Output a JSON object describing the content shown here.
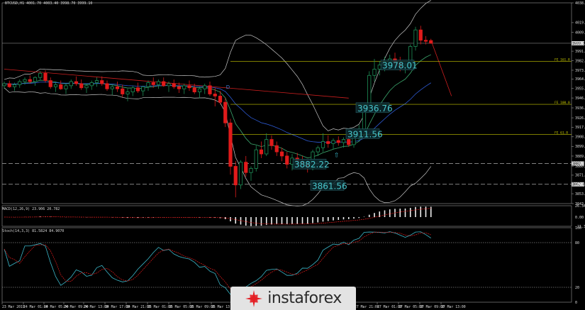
{
  "header": {
    "main_info": "BTCUSD,H1  4001.70 4003.40 3998.70 3999.10",
    "macd_info": "MACD(12,26,9) 23.906 20.782",
    "stoch_info": "Stoch(14,3,3) 81.5824 84.9070"
  },
  "chart_data": [
    {
      "type": "candlestick",
      "symbol": "BTCUSD",
      "timeframe": "H1",
      "ohlc_last": {
        "open": 4001.7,
        "high": 4003.4,
        "low": 3998.7,
        "close": 3999.1
      },
      "current_price": "3999.10",
      "ylim": [
        3843.95,
        4038.2
      ],
      "y_ticks": [
        "4038.20",
        "4019.05",
        "4009.70",
        "3999.10",
        "3991.45",
        "3982.25",
        "3973.00",
        "3964.45",
        "3955.30",
        "3946.15",
        "3936.60",
        "3926.95",
        "3917.80",
        "3908.60",
        "3899.25",
        "3889.95",
        "3880.25",
        "3871.45",
        "3862.60",
        "3853.50",
        "3843.95"
      ],
      "x_ticks": [
        "23 Mar 2019",
        "24 Mar 01:00",
        "24 Mar 05:00",
        "24 Mar 09:00",
        "24 Mar 13:00",
        "24 Mar 17:00",
        "24 Mar 21:00",
        "25 Mar 01:00",
        "25 Mar 05:00",
        "25 Mar 09:00",
        "25 Mar 13:00",
        "25 Mar 17:00",
        "27 Mar 21:00",
        "27 Mar 01:00",
        "27 Mar 05:00",
        "27 Mar 09:00",
        "27 Mar 13:00"
      ],
      "candles": [
        [
          3958,
          3962,
          3955,
          3960
        ],
        [
          3960,
          3963,
          3956,
          3957
        ],
        [
          3957,
          3961,
          3953,
          3959
        ],
        [
          3959,
          3964,
          3956,
          3962
        ],
        [
          3962,
          3966,
          3959,
          3964
        ],
        [
          3964,
          3968,
          3960,
          3962
        ],
        [
          3962,
          3967,
          3958,
          3966
        ],
        [
          3966,
          3972,
          3963,
          3970
        ],
        [
          3970,
          3973,
          3961,
          3963
        ],
        [
          3963,
          3966,
          3955,
          3957
        ],
        [
          3957,
          3961,
          3952,
          3959
        ],
        [
          3959,
          3963,
          3954,
          3955
        ],
        [
          3955,
          3960,
          3950,
          3958
        ],
        [
          3958,
          3964,
          3955,
          3962
        ],
        [
          3962,
          3967,
          3958,
          3960
        ],
        [
          3960,
          3964,
          3954,
          3956
        ],
        [
          3956,
          3960,
          3951,
          3958
        ],
        [
          3958,
          3963,
          3954,
          3961
        ],
        [
          3961,
          3966,
          3957,
          3963
        ],
        [
          3963,
          3967,
          3958,
          3960
        ],
        [
          3960,
          3963,
          3953,
          3955
        ],
        [
          3955,
          3959,
          3949,
          3957
        ],
        [
          3957,
          3962,
          3952,
          3955
        ],
        [
          3955,
          3959,
          3947,
          3950
        ],
        [
          3950,
          3955,
          3943,
          3952
        ],
        [
          3952,
          3958,
          3948,
          3956
        ],
        [
          3956,
          3961,
          3951,
          3953
        ],
        [
          3953,
          3958,
          3948,
          3957
        ],
        [
          3957,
          3963,
          3953,
          3961
        ],
        [
          3961,
          3966,
          3956,
          3959
        ],
        [
          3959,
          3964,
          3955,
          3962
        ],
        [
          3962,
          3966,
          3957,
          3958
        ],
        [
          3958,
          3962,
          3952,
          3960
        ],
        [
          3960,
          3964,
          3955,
          3957
        ],
        [
          3957,
          3961,
          3951,
          3955
        ],
        [
          3955,
          3960,
          3950,
          3958
        ],
        [
          3958,
          3963,
          3953,
          3956
        ],
        [
          3956,
          3960,
          3950,
          3952
        ],
        [
          3952,
          3957,
          3946,
          3955
        ],
        [
          3955,
          3960,
          3950,
          3958
        ],
        [
          3958,
          3962,
          3948,
          3950
        ],
        [
          3950,
          3956,
          3938,
          3948
        ],
        [
          3948,
          3953,
          3940,
          3942
        ],
        [
          3942,
          3946,
          3918,
          3922
        ],
        [
          3922,
          3926,
          3872,
          3880
        ],
        [
          3880,
          3885,
          3850,
          3862
        ],
        [
          3862,
          3886,
          3858,
          3884
        ],
        [
          3884,
          3890,
          3870,
          3874
        ],
        [
          3874,
          3880,
          3866,
          3878
        ],
        [
          3878,
          3900,
          3875,
          3896
        ],
        [
          3896,
          3904,
          3888,
          3892
        ],
        [
          3892,
          3912,
          3890,
          3906
        ],
        [
          3906,
          3910,
          3896,
          3900
        ],
        [
          3900,
          3904,
          3890,
          3894
        ],
        [
          3894,
          3898,
          3885,
          3890
        ],
        [
          3890,
          3894,
          3878,
          3882
        ],
        [
          3882,
          3892,
          3876,
          3888
        ],
        [
          3888,
          3893,
          3880,
          3885
        ],
        [
          3885,
          3890,
          3878,
          3882
        ],
        [
          3882,
          3886,
          3874,
          3879
        ],
        [
          3879,
          3896,
          3876,
          3894
        ],
        [
          3894,
          3900,
          3890,
          3898
        ],
        [
          3898,
          3912,
          3894,
          3904
        ],
        [
          3904,
          3910,
          3898,
          3902
        ],
        [
          3902,
          3907,
          3897,
          3905
        ],
        [
          3905,
          3909,
          3900,
          3903
        ],
        [
          3903,
          3908,
          3898,
          3906
        ],
        [
          3906,
          3910,
          3899,
          3901
        ],
        [
          3901,
          3912,
          3898,
          3910
        ],
        [
          3910,
          3920,
          3905,
          3916
        ],
        [
          3916,
          3940,
          3913,
          3937
        ],
        [
          3937,
          3972,
          3934,
          3968
        ],
        [
          3968,
          3984,
          3962,
          3974
        ],
        [
          3974,
          3982,
          3968,
          3978
        ],
        [
          3978,
          3986,
          3972,
          3980
        ],
        [
          3980,
          3988,
          3975,
          3984
        ],
        [
          3984,
          3990,
          3976,
          3980
        ],
        [
          3980,
          3986,
          3972,
          3976
        ],
        [
          3976,
          3980,
          3970,
          3978
        ],
        [
          3978,
          3998,
          3975,
          3996
        ],
        [
          3996,
          4015,
          3992,
          4012
        ],
        [
          4012,
          4016,
          3998,
          4002
        ],
        [
          4002,
          4006,
          3998,
          4001
        ],
        [
          4001.7,
          4003.4,
          3998.7,
          3999.1
        ]
      ],
      "annotations": [
        {
          "text": "3978.01",
          "price": 3978.01
        },
        {
          "text": "3936.76",
          "price": 3936.76
        },
        {
          "text": "3911.56",
          "price": 3911.56
        },
        {
          "text": "3882.22",
          "price": 3882.22
        },
        {
          "text": "3861.56",
          "price": 3861.56
        }
      ],
      "horizontal_levels": [
        {
          "label": "FE 161.8",
          "price": 3981.5,
          "style": "solid",
          "color": "#c8c800"
        },
        {
          "label": "FE 100.0",
          "price": 3940.0,
          "style": "solid",
          "color": "#c8c800"
        },
        {
          "label": "FE 61.8",
          "price": 3911.0,
          "style": "solid",
          "color": "#c8c800"
        },
        {
          "label": "3882.76",
          "price": 3882.76,
          "style": "dashed",
          "color": "#d0d0d0"
        },
        {
          "label": "3862.60",
          "price": 3862.6,
          "style": "dashed",
          "color": "#d0d0d0"
        }
      ],
      "marker_labels": {
        "down": "D",
        "up": "⇧"
      },
      "colors": {
        "bull": "#1e8f57",
        "bear": "#e01b1b",
        "ma_fast": "#3ca86e",
        "ma_slow": "#2e5bd6",
        "bands": "#c8c8c8",
        "trend": "#cc1f1f",
        "annot_text": "#47c3c9"
      }
    },
    {
      "type": "bar",
      "indicator": "MACD",
      "params": "12,26,9",
      "value": 23.906,
      "signal": 20.782,
      "y_ticks": [
        "26.348",
        "0.00",
        "-21.343"
      ],
      "ylim": [
        -21.343,
        26.348
      ]
    },
    {
      "type": "line",
      "indicator": "Stochastic",
      "params": "14,3,3",
      "k": 81.5824,
      "d": 84.907,
      "ylim": [
        0,
        100
      ],
      "y_ticks": [
        "100",
        "80",
        "20",
        "0"
      ],
      "levels": [
        80,
        20
      ]
    }
  ],
  "logo": {
    "text": "instaforex",
    "accent": "#e31e24"
  }
}
